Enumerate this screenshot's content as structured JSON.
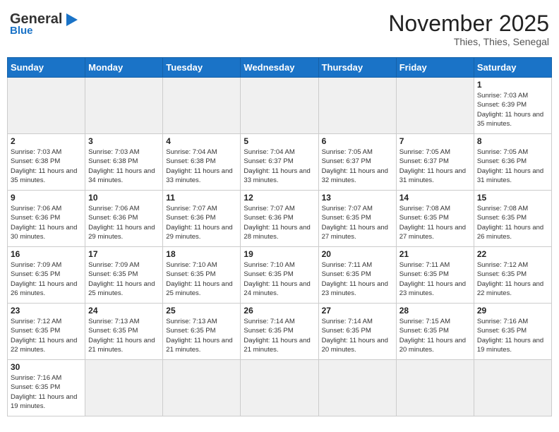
{
  "header": {
    "logo_general": "General",
    "logo_blue": "Blue",
    "month_year": "November 2025",
    "location": "Thies, Thies, Senegal"
  },
  "weekdays": [
    "Sunday",
    "Monday",
    "Tuesday",
    "Wednesday",
    "Thursday",
    "Friday",
    "Saturday"
  ],
  "weeks": [
    [
      {
        "day": "",
        "empty": true
      },
      {
        "day": "",
        "empty": true
      },
      {
        "day": "",
        "empty": true
      },
      {
        "day": "",
        "empty": true
      },
      {
        "day": "",
        "empty": true
      },
      {
        "day": "",
        "empty": true
      },
      {
        "day": "1",
        "sunrise": "7:03 AM",
        "sunset": "6:39 PM",
        "daylight": "11 hours and 35 minutes."
      }
    ],
    [
      {
        "day": "2",
        "sunrise": "7:03 AM",
        "sunset": "6:38 PM",
        "daylight": "11 hours and 35 minutes."
      },
      {
        "day": "3",
        "sunrise": "7:03 AM",
        "sunset": "6:38 PM",
        "daylight": "11 hours and 34 minutes."
      },
      {
        "day": "4",
        "sunrise": "7:04 AM",
        "sunset": "6:38 PM",
        "daylight": "11 hours and 33 minutes."
      },
      {
        "day": "5",
        "sunrise": "7:04 AM",
        "sunset": "6:37 PM",
        "daylight": "11 hours and 33 minutes."
      },
      {
        "day": "6",
        "sunrise": "7:05 AM",
        "sunset": "6:37 PM",
        "daylight": "11 hours and 32 minutes."
      },
      {
        "day": "7",
        "sunrise": "7:05 AM",
        "sunset": "6:37 PM",
        "daylight": "11 hours and 31 minutes."
      },
      {
        "day": "8",
        "sunrise": "7:05 AM",
        "sunset": "6:36 PM",
        "daylight": "11 hours and 31 minutes."
      }
    ],
    [
      {
        "day": "9",
        "sunrise": "7:06 AM",
        "sunset": "6:36 PM",
        "daylight": "11 hours and 30 minutes."
      },
      {
        "day": "10",
        "sunrise": "7:06 AM",
        "sunset": "6:36 PM",
        "daylight": "11 hours and 29 minutes."
      },
      {
        "day": "11",
        "sunrise": "7:07 AM",
        "sunset": "6:36 PM",
        "daylight": "11 hours and 29 minutes."
      },
      {
        "day": "12",
        "sunrise": "7:07 AM",
        "sunset": "6:36 PM",
        "daylight": "11 hours and 28 minutes."
      },
      {
        "day": "13",
        "sunrise": "7:07 AM",
        "sunset": "6:35 PM",
        "daylight": "11 hours and 27 minutes."
      },
      {
        "day": "14",
        "sunrise": "7:08 AM",
        "sunset": "6:35 PM",
        "daylight": "11 hours and 27 minutes."
      },
      {
        "day": "15",
        "sunrise": "7:08 AM",
        "sunset": "6:35 PM",
        "daylight": "11 hours and 26 minutes."
      }
    ],
    [
      {
        "day": "16",
        "sunrise": "7:09 AM",
        "sunset": "6:35 PM",
        "daylight": "11 hours and 26 minutes."
      },
      {
        "day": "17",
        "sunrise": "7:09 AM",
        "sunset": "6:35 PM",
        "daylight": "11 hours and 25 minutes."
      },
      {
        "day": "18",
        "sunrise": "7:10 AM",
        "sunset": "6:35 PM",
        "daylight": "11 hours and 25 minutes."
      },
      {
        "day": "19",
        "sunrise": "7:10 AM",
        "sunset": "6:35 PM",
        "daylight": "11 hours and 24 minutes."
      },
      {
        "day": "20",
        "sunrise": "7:11 AM",
        "sunset": "6:35 PM",
        "daylight": "11 hours and 23 minutes."
      },
      {
        "day": "21",
        "sunrise": "7:11 AM",
        "sunset": "6:35 PM",
        "daylight": "11 hours and 23 minutes."
      },
      {
        "day": "22",
        "sunrise": "7:12 AM",
        "sunset": "6:35 PM",
        "daylight": "11 hours and 22 minutes."
      }
    ],
    [
      {
        "day": "23",
        "sunrise": "7:12 AM",
        "sunset": "6:35 PM",
        "daylight": "11 hours and 22 minutes."
      },
      {
        "day": "24",
        "sunrise": "7:13 AM",
        "sunset": "6:35 PM",
        "daylight": "11 hours and 21 minutes."
      },
      {
        "day": "25",
        "sunrise": "7:13 AM",
        "sunset": "6:35 PM",
        "daylight": "11 hours and 21 minutes."
      },
      {
        "day": "26",
        "sunrise": "7:14 AM",
        "sunset": "6:35 PM",
        "daylight": "11 hours and 21 minutes."
      },
      {
        "day": "27",
        "sunrise": "7:14 AM",
        "sunset": "6:35 PM",
        "daylight": "11 hours and 20 minutes."
      },
      {
        "day": "28",
        "sunrise": "7:15 AM",
        "sunset": "6:35 PM",
        "daylight": "11 hours and 20 minutes."
      },
      {
        "day": "29",
        "sunrise": "7:16 AM",
        "sunset": "6:35 PM",
        "daylight": "11 hours and 19 minutes."
      }
    ],
    [
      {
        "day": "30",
        "sunrise": "7:16 AM",
        "sunset": "6:35 PM",
        "daylight": "11 hours and 19 minutes.",
        "last": true
      },
      {
        "day": "",
        "empty": true,
        "last": true
      },
      {
        "day": "",
        "empty": true,
        "last": true
      },
      {
        "day": "",
        "empty": true,
        "last": true
      },
      {
        "day": "",
        "empty": true,
        "last": true
      },
      {
        "day": "",
        "empty": true,
        "last": true
      },
      {
        "day": "",
        "empty": true,
        "last": true
      }
    ]
  ]
}
